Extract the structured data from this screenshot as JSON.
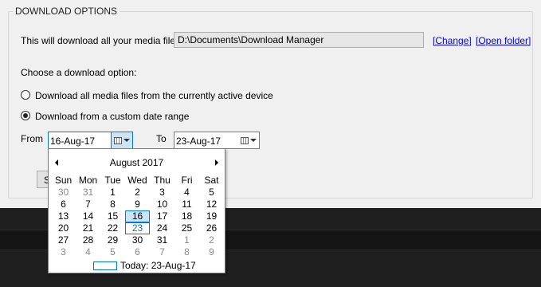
{
  "group": {
    "title": "DOWNLOAD OPTIONS"
  },
  "destination": {
    "label": "This will download all your media files to",
    "path": "D:\\Documents\\Download Manager",
    "change_link": "[Change]",
    "open_folder_link": "[Open folder]"
  },
  "options": {
    "heading": "Choose a download option:",
    "all_files_label": "Download all media files from the currently active device",
    "custom_range_label": "Download from a custom date range",
    "selected": "custom_range"
  },
  "range": {
    "from_label": "From",
    "from_value": "16-Aug-17",
    "to_label": "To",
    "to_value": "23-Aug-17"
  },
  "hidden_button": {
    "label": "S"
  },
  "calendar": {
    "month_title": "August 2017",
    "weekdays": [
      "Sun",
      "Mon",
      "Tue",
      "Wed",
      "Thu",
      "Fri",
      "Sat"
    ],
    "weeks": [
      [
        {
          "d": "30",
          "o": true
        },
        {
          "d": "31",
          "o": true
        },
        {
          "d": "1"
        },
        {
          "d": "2"
        },
        {
          "d": "3"
        },
        {
          "d": "4"
        },
        {
          "d": "5"
        }
      ],
      [
        {
          "d": "6"
        },
        {
          "d": "7"
        },
        {
          "d": "8"
        },
        {
          "d": "9"
        },
        {
          "d": "10"
        },
        {
          "d": "11"
        },
        {
          "d": "12"
        }
      ],
      [
        {
          "d": "13"
        },
        {
          "d": "14"
        },
        {
          "d": "15"
        },
        {
          "d": "16",
          "selected": true
        },
        {
          "d": "17"
        },
        {
          "d": "18"
        },
        {
          "d": "19"
        }
      ],
      [
        {
          "d": "20"
        },
        {
          "d": "21"
        },
        {
          "d": "22"
        },
        {
          "d": "23",
          "today": true
        },
        {
          "d": "24"
        },
        {
          "d": "25"
        },
        {
          "d": "26"
        }
      ],
      [
        {
          "d": "27"
        },
        {
          "d": "28"
        },
        {
          "d": "29"
        },
        {
          "d": "30"
        },
        {
          "d": "31"
        },
        {
          "d": "1",
          "o": true
        },
        {
          "d": "2",
          "o": true
        }
      ],
      [
        {
          "d": "3",
          "o": true
        },
        {
          "d": "4",
          "o": true
        },
        {
          "d": "5",
          "o": true
        },
        {
          "d": "6",
          "o": true
        },
        {
          "d": "7",
          "o": true
        },
        {
          "d": "8",
          "o": true
        },
        {
          "d": "9",
          "o": true
        }
      ]
    ],
    "today_label": "Today: 23-Aug-17"
  },
  "colors": {
    "accent": "#0078d7",
    "link": "#0000ee",
    "selected_bg": "#cce4f7",
    "dark_panel": "#1e1e1e"
  }
}
